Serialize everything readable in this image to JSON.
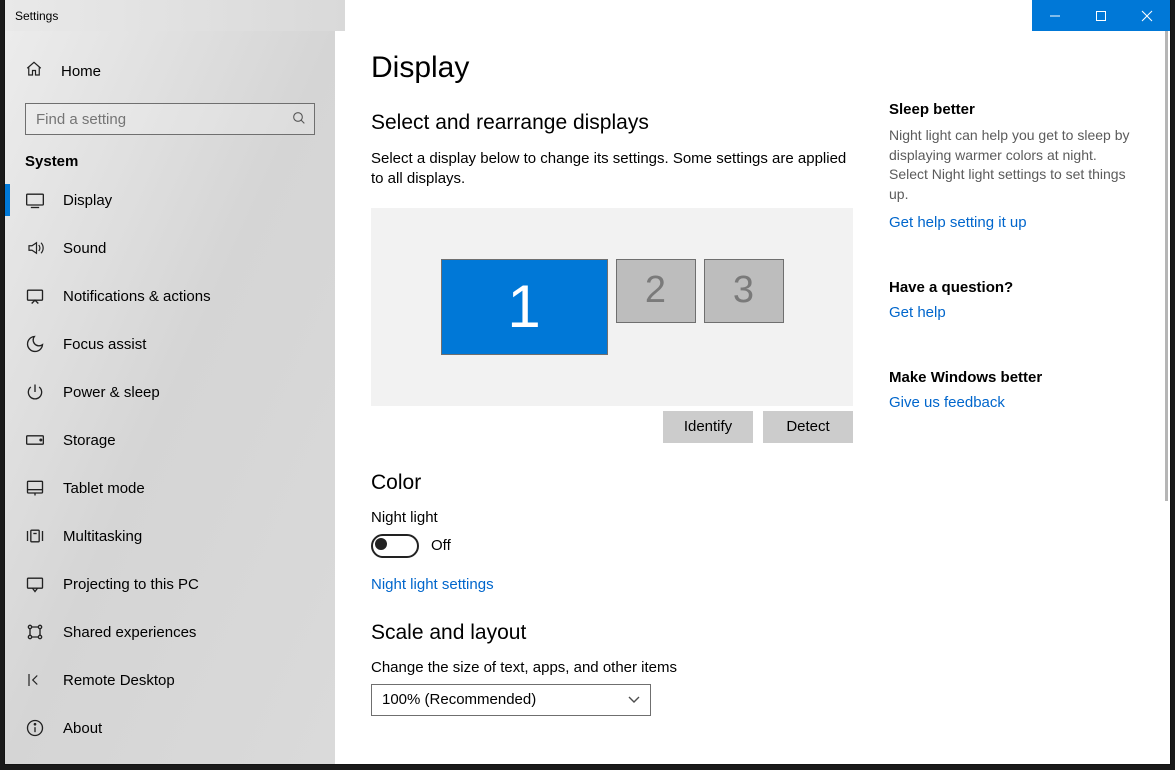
{
  "titlebar": {
    "app": "Settings"
  },
  "sidebar": {
    "home": "Home",
    "search_placeholder": "Find a setting",
    "category": "System",
    "items": [
      {
        "id": "display",
        "label": "Display",
        "active": true
      },
      {
        "id": "sound",
        "label": "Sound"
      },
      {
        "id": "notifications",
        "label": "Notifications & actions"
      },
      {
        "id": "focus",
        "label": "Focus assist"
      },
      {
        "id": "power",
        "label": "Power & sleep"
      },
      {
        "id": "storage",
        "label": "Storage"
      },
      {
        "id": "tablet",
        "label": "Tablet mode"
      },
      {
        "id": "multitask",
        "label": "Multitasking"
      },
      {
        "id": "projecting",
        "label": "Projecting to this PC"
      },
      {
        "id": "shared",
        "label": "Shared experiences"
      },
      {
        "id": "remote",
        "label": "Remote Desktop"
      },
      {
        "id": "about",
        "label": "About"
      }
    ]
  },
  "content": {
    "page_title": "Display",
    "rearrange_title": "Select and rearrange displays",
    "rearrange_desc": "Select a display below to change its settings. Some settings are applied to all displays.",
    "displays": [
      {
        "num": "1",
        "primary": true
      },
      {
        "num": "2",
        "primary": false
      },
      {
        "num": "3",
        "primary": false
      }
    ],
    "identify_btn": "Identify",
    "detect_btn": "Detect",
    "color_title": "Color",
    "night_light_label": "Night light",
    "night_light_state": "Off",
    "night_light_link": "Night light settings",
    "scale_title": "Scale and layout",
    "scale_label": "Change the size of text, apps, and other items",
    "scale_value": "100% (Recommended)"
  },
  "side": {
    "sleep": {
      "title": "Sleep better",
      "body": "Night light can help you get to sleep by displaying warmer colors at night. Select Night light settings to set things up.",
      "link": "Get help setting it up"
    },
    "question": {
      "title": "Have a question?",
      "link": "Get help"
    },
    "feedback": {
      "title": "Make Windows better",
      "link": "Give us feedback"
    }
  }
}
